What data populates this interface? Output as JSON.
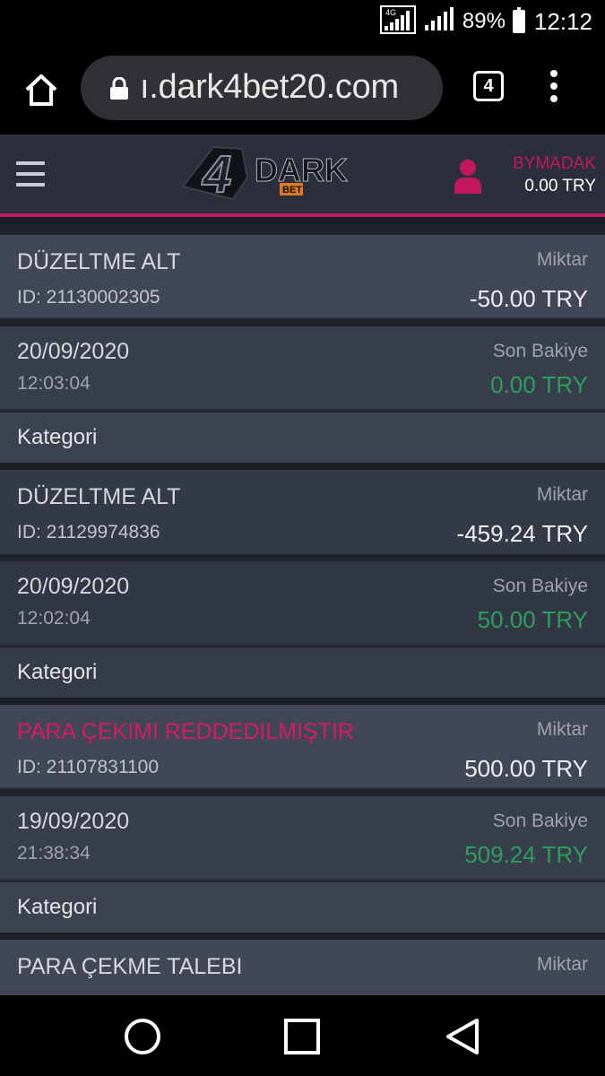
{
  "status": {
    "network": "4G",
    "battery": "89%",
    "clock": "12:12"
  },
  "browser": {
    "url": "ı.dark4bet20.com",
    "tab_count": "4"
  },
  "site": {
    "logo_alt": "4 DARK BET",
    "user": {
      "name": "BYMADAK",
      "balance": "0.00 TRY"
    }
  },
  "labels": {
    "amount": "Miktar",
    "last_balance": "Son Bakiye",
    "category": "Kategori"
  },
  "transactions": [
    {
      "title": "DÜZELTME ALT",
      "id": "ID: 21130002305",
      "amount": "-50.00 TRY",
      "date": "20/09/2020",
      "time": "12:03:04",
      "balance": "0.00 TRY",
      "status_color": "#d5d8df"
    },
    {
      "title": "DÜZELTME ALT",
      "id": "ID: 21129974836",
      "amount": "-459.24 TRY",
      "date": "20/09/2020",
      "time": "12:02:04",
      "balance": "50.00 TRY",
      "status_color": "#d5d8df"
    },
    {
      "title": "PARA ÇEKIMI REDDEDILMIŞTIR",
      "id": "ID: 21107831100",
      "amount": "500.00 TRY",
      "date": "19/09/2020",
      "time": "21:38:34",
      "balance": "509.24 TRY",
      "status_color": "#d81b60"
    },
    {
      "title": "PARA ÇEKME TALEBI"
    }
  ],
  "colors": {
    "accent": "#c2185b",
    "positive": "#2e9e5e",
    "header_bg": "#2b2f3b"
  }
}
